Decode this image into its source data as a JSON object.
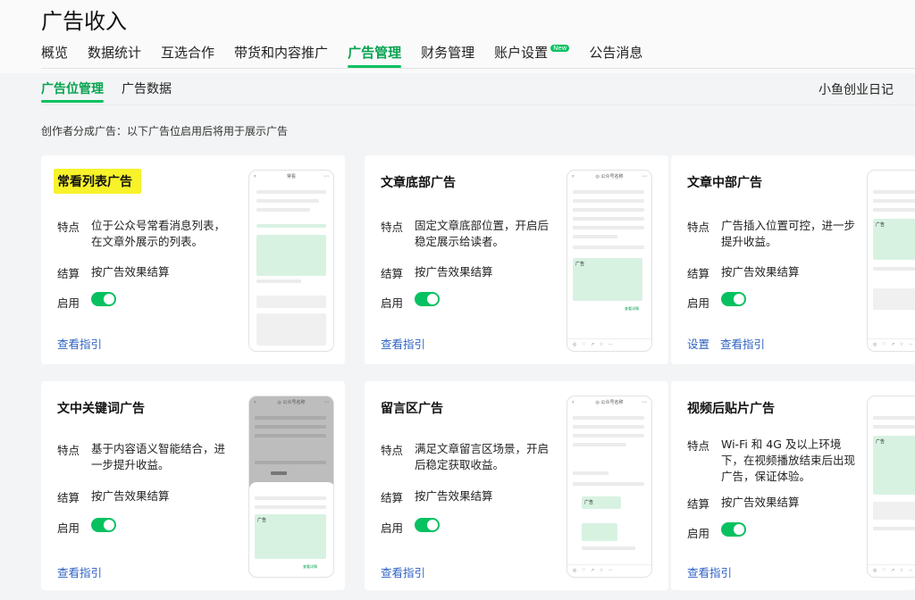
{
  "header": {
    "title": "广告收入"
  },
  "main_nav": [
    {
      "label": "概览"
    },
    {
      "label": "数据统计"
    },
    {
      "label": "互选合作"
    },
    {
      "label": "带货和内容推广"
    },
    {
      "label": "广告管理",
      "active": true
    },
    {
      "label": "财务管理"
    },
    {
      "label": "账户设置",
      "badge": "New"
    },
    {
      "label": "公告消息"
    }
  ],
  "sub_nav": [
    {
      "label": "广告位管理",
      "active": true
    },
    {
      "label": "广告数据"
    }
  ],
  "account_name": "小鱼创业日记",
  "intro": "创作者分成广告：以下广告位启用后将用于展示广告",
  "labels": {
    "feature": "特点",
    "settlement": "结算",
    "enable": "启用"
  },
  "cards": [
    {
      "title": "常看列表广告",
      "feature": "位于公众号常看消息列表，在文章外展示的列表。",
      "settlement": "按广告效果结算",
      "enabled": true,
      "link": "查看指引"
    },
    {
      "title": "文章底部广告",
      "feature": "固定文章底部位置，开启后稳定展示给读者。",
      "settlement": "按广告效果结算",
      "enabled": true,
      "link": "查看指引"
    },
    {
      "title": "文章中部广告",
      "feature": "广告插入位置可控，进一步提升收益。",
      "settlement": "按广告效果结算",
      "enabled": true,
      "link_setup": "设置",
      "link": "查看指引"
    },
    {
      "title": "文中关键词广告",
      "feature": "基于内容语义智能结合，进一步提升收益。",
      "settlement": "按广告效果结算",
      "enabled": true,
      "link": "查看指引"
    },
    {
      "title": "留言区广告",
      "feature": "满足文章留言区场景，开启后稳定获取收益。",
      "settlement": "按广告效果结算",
      "enabled": true,
      "link": "查看指引"
    },
    {
      "title": "视频后贴片广告",
      "feature": "Wi-Fi 和 4G 及以上环境下，在视频播放结束后出现广告，保证体验。",
      "settlement": "按广告效果结算",
      "enabled": true,
      "link": "查看指引"
    }
  ],
  "mockups": {
    "header_1": "常看",
    "header_article": "◎ 公众号名称",
    "ad_label": "广告",
    "ad_label_kw": "广告",
    "ad_cta": "查看详情",
    "footer_icons": "◎ ♡ ↗ ☆ ⋯"
  },
  "colors": {
    "accent": "#07c160",
    "link": "#2f62c2",
    "ad_bg": "#d8f2e2",
    "highlight": "#f7f22a"
  }
}
